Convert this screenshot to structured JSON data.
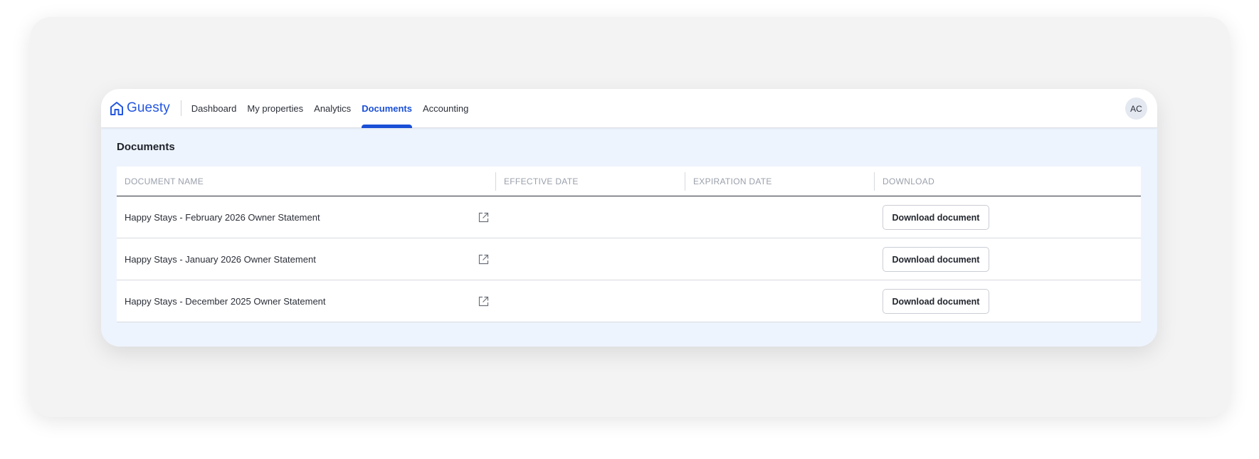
{
  "brand": {
    "name": "Guesty",
    "accent": "#1a4fd6"
  },
  "nav": {
    "items": [
      {
        "label": "Dashboard",
        "active": false
      },
      {
        "label": "My properties",
        "active": false
      },
      {
        "label": "Analytics",
        "active": false
      },
      {
        "label": "Documents",
        "active": true
      },
      {
        "label": "Accounting",
        "active": false
      }
    ]
  },
  "user": {
    "initials": "AC"
  },
  "page": {
    "title": "Documents"
  },
  "table": {
    "columns": [
      "DOCUMENT NAME",
      "EFFECTIVE DATE",
      "EXPIRATION DATE",
      "DOWNLOAD"
    ],
    "rows": [
      {
        "name": "Happy Stays - February 2026 Owner Statement",
        "effective_date": "",
        "expiration_date": "",
        "action_label": "Download document",
        "icon": "external-link-icon"
      },
      {
        "name": "Happy Stays - January 2026 Owner Statement",
        "effective_date": "",
        "expiration_date": "",
        "action_label": "Download document",
        "icon": "external-link-icon"
      },
      {
        "name": "Happy Stays - December 2025 Owner Statement",
        "effective_date": "",
        "expiration_date": "",
        "action_label": "Download document",
        "icon": "external-link-icon"
      }
    ]
  }
}
